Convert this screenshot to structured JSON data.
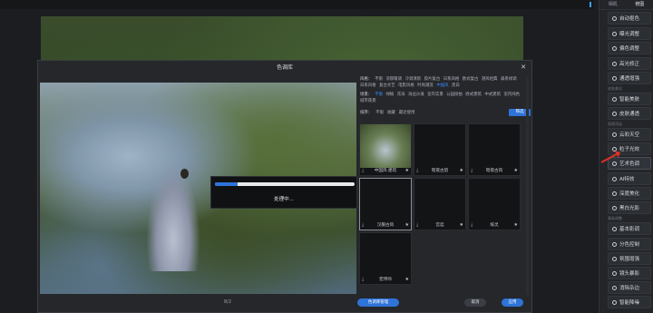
{
  "right_panel": {
    "tabs": [
      "相机",
      "修图"
    ],
    "items_top": [
      {
        "label": "自动抠色",
        "icon": "auto-color-icon"
      },
      {
        "label": "曝光调整",
        "icon": "exposure-icon"
      },
      {
        "label": "偏色调整",
        "icon": "color-cast-icon"
      },
      {
        "label": "高光修正",
        "icon": "highlight-icon"
      },
      {
        "label": "通透增强",
        "icon": "clarity-icon"
      }
    ],
    "section_2": "皮肤美化",
    "items_mid": [
      {
        "label": "智能美肤",
        "icon": "smart-beauty-icon"
      },
      {
        "label": "皮肤通透",
        "icon": "skin-clear-icon"
      }
    ],
    "section_3": "氛围渲染",
    "items_low": [
      {
        "label": "云彩天空",
        "icon": "sky-icon"
      },
      {
        "label": "粒子光效",
        "icon": "particle-icon"
      },
      {
        "label": "艺术色调",
        "icon": "art-tone-icon"
      },
      {
        "label": "AI特效",
        "icon": "ai-effect-icon"
      },
      {
        "label": "深度美化",
        "icon": "deep-beauty-icon"
      },
      {
        "label": "黑白光影",
        "icon": "bw-light-icon"
      }
    ],
    "section_4": "基础调整",
    "items_bottom": [
      {
        "label": "基本影调",
        "icon": "tone-icon"
      },
      {
        "label": "分色控制",
        "icon": "hsl-icon"
      },
      {
        "label": "氛围增强",
        "icon": "ambience-icon"
      },
      {
        "label": "镜头暴影",
        "icon": "lens-icon"
      },
      {
        "label": "消除杂边",
        "icon": "defringe-icon"
      },
      {
        "label": "智能降噪",
        "icon": "denoise-icon"
      }
    ]
  },
  "dialog": {
    "title": "色调库",
    "progress": {
      "label": "处理中...",
      "fraction": 0.16
    },
    "filters": {
      "style": {
        "label": "风格：",
        "options": [
          "不限",
          "浓郁暖调",
          "冷调清新",
          "胶片复古",
          "日系风格",
          "欧式复古",
          "港风经典",
          "森系绿调",
          "日系风格",
          "复古文艺",
          "电影风格",
          "时尚潮流",
          "中国风",
          "黑白"
        ],
        "selected": "中国风"
      },
      "scene": {
        "label": "场景：",
        "options": [
          "不限",
          "绿植",
          "花海",
          "海边沙滩",
          "室内实景",
          "公园街拍",
          "欧式建筑",
          "中式建筑",
          "室内纯色",
          "城市夜景"
        ],
        "selected": "不限"
      },
      "sort": {
        "label": "排序：",
        "options": [
          "不限",
          "收藏",
          "最近使用"
        ]
      },
      "apply_label": "筛选"
    },
    "tiles": [
      {
        "name": "中国风·建筑",
        "thumb": "photo"
      },
      {
        "name": "暗夜古韵",
        "thumb": "dark"
      },
      {
        "name": "暗夜古风",
        "thumb": "dark"
      },
      {
        "name": "汉服古风",
        "thumb": "dark",
        "selected": true
      },
      {
        "name": "宫廷",
        "thumb": "dark"
      },
      {
        "name": "绯灵",
        "thumb": "dark"
      },
      {
        "name": "宏伟师",
        "thumb": "dark"
      }
    ],
    "bottom": {
      "page": "8/2",
      "btn_left": "色调库管理",
      "btn_cancel": "取消",
      "btn_ok": "应用"
    }
  }
}
